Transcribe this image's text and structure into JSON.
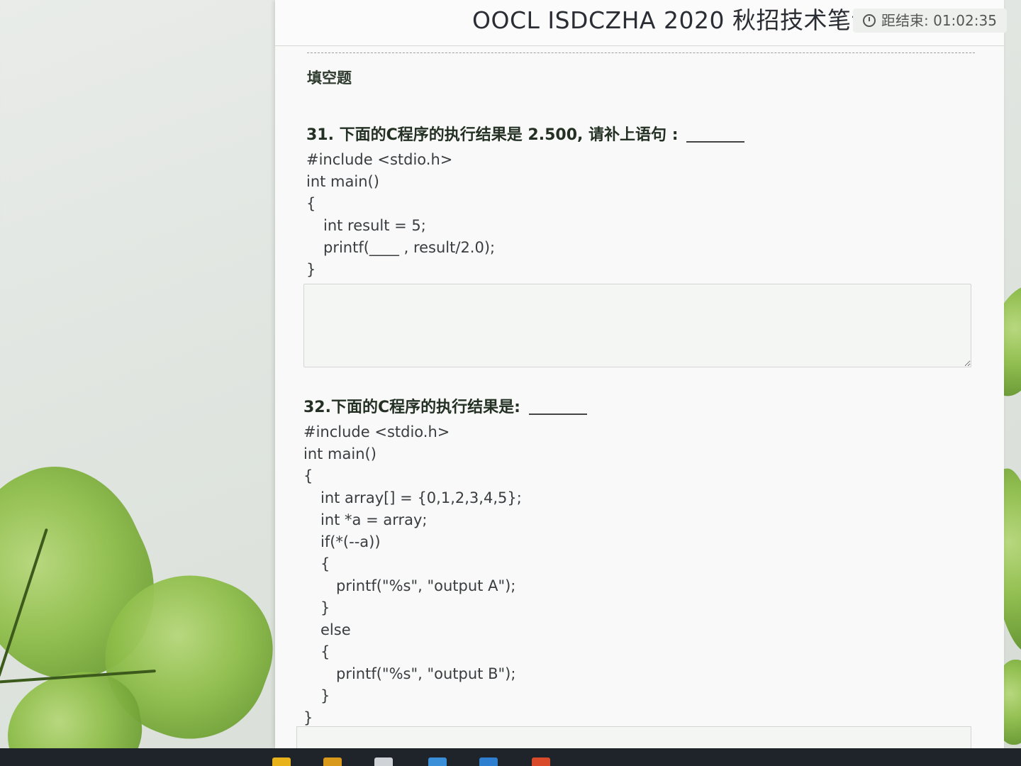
{
  "exam": {
    "title": "OOCL ISDCZHA 2020 秋招技术笔试",
    "timer_label": "距结束: 01:02:35"
  },
  "section": {
    "title": "填空题"
  },
  "questions": [
    {
      "prompt": "31. 下面的C程序的执行结果是 2.500, 请补上语句 :",
      "code": [
        "#include <stdio.h>",
        "int main()",
        "{",
        "int result = 5;",
        "printf(____ , result/2.0);",
        "}"
      ]
    },
    {
      "prompt": "32.下面的C程序的执行结果是:",
      "code": [
        "#include <stdio.h>",
        "int main()",
        "{",
        "int array[] = {0,1,2,3,4,5};",
        "int *a = array;",
        "if(*(--a))",
        "{",
        "printf(\"%s\", \"output A\");",
        "}",
        "else",
        "{",
        "printf(\"%s\", \"output B\");",
        "}",
        "}"
      ]
    }
  ],
  "colors": {
    "leaf_green": "#8fbe4a",
    "page_background": "#f8f9f8",
    "taskbar": "#1f242a"
  },
  "icons": [
    "alarm-clock-icon"
  ]
}
